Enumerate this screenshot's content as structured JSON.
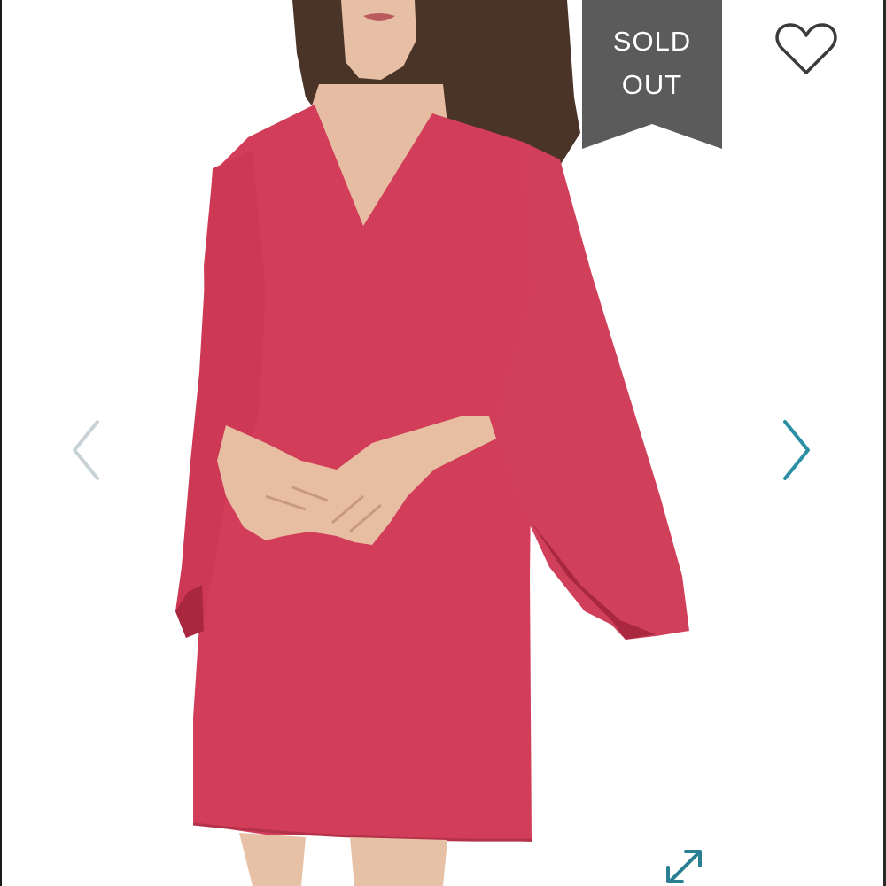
{
  "listing": {
    "badge": {
      "line1": "SOLD",
      "line2": "OUT"
    },
    "colors": {
      "badge_bg": "#5b5b5b",
      "dress": "#d23e5a",
      "dress_shadow": "#a9283f",
      "skin": "#e9c2a8",
      "hair": "#4a3428",
      "nav_prev": "#c9d2d6",
      "nav_next": "#2b8fa3",
      "heart_stroke": "#3a3a3a",
      "expand_icon": "#2b7f93"
    },
    "icons": {
      "favorite": "heart-outline-icon",
      "previous": "chevron-left-icon",
      "next": "chevron-right-icon",
      "fullscreen": "expand-arrows-icon"
    }
  }
}
